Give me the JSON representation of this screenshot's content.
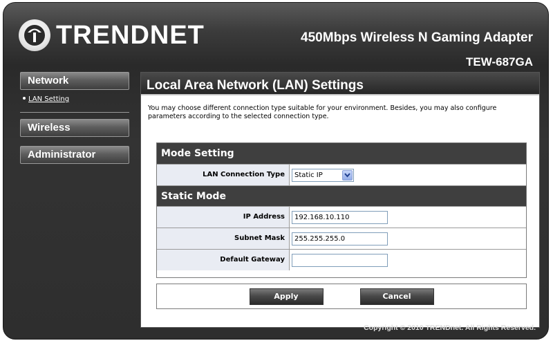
{
  "brand": {
    "logo_text": "TRENDNET"
  },
  "product": {
    "name": "450Mbps Wireless N Gaming Adapter",
    "model": "TEW-687GA"
  },
  "sidebar": {
    "items": [
      {
        "label": "Network"
      },
      {
        "label": "Wireless"
      },
      {
        "label": "Administrator"
      }
    ],
    "sub_items": [
      {
        "label": "LAN Setting"
      }
    ]
  },
  "page": {
    "title": "Local Area Network (LAN) Settings",
    "description": "You may choose different connection type suitable for your environment. Besides, you may also configure parameters according to the selected connection type."
  },
  "mode_setting": {
    "heading": "Mode Setting",
    "lan_type_label": "LAN Connection Type",
    "lan_type_value": "Static IP"
  },
  "static_mode": {
    "heading": "Static Mode",
    "ip_label": "IP Address",
    "ip_value": "192.168.10.110",
    "mask_label": "Subnet Mask",
    "mask_value": "255.255.255.0",
    "gateway_label": "Default Gateway",
    "gateway_value": ""
  },
  "buttons": {
    "apply": "Apply",
    "cancel": "Cancel"
  },
  "footer": {
    "copyright": "Copyright © 2010 TRENDnet. All Rights Reserved."
  }
}
